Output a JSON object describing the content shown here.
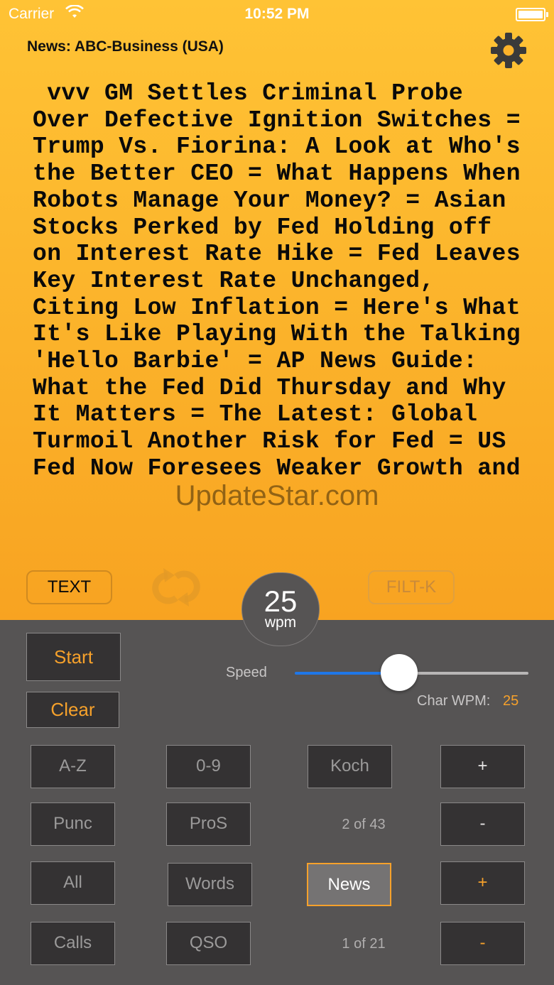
{
  "status_bar": {
    "carrier": "Carrier",
    "time": "10:52 PM"
  },
  "header": {
    "title": "News: ABC-Business (USA)"
  },
  "feed_text": " vvv GM Settles Criminal Probe Over Defective Ignition Switches = Trump Vs. Fiorina: A Look at Who's the Better CEO = What Happens When Robots Manage Your Money? = Asian Stocks Perked by Fed Holding off on Interest Rate Hike = Fed Leaves Key Interest Rate Unchanged, Citing Low Inflation = Here's What It's Like Playing With the Talking 'Hello Barbie' = AP News Guide: What the Fed Did Thursday and Why It Matters = The Latest: Global Turmoil Another Risk for Fed = US Fed Now Foresees Weaker Growth and",
  "watermark": "UpdateStar.com",
  "mode_buttons": {
    "text": "TEXT",
    "filter": "FILT-K"
  },
  "wpm": {
    "value": "25",
    "unit": "wpm"
  },
  "controls": {
    "start": "Start",
    "clear": "Clear",
    "speed_label": "Speed",
    "speed_level": 0.45,
    "char_wpm_label": "Char WPM:",
    "char_wpm_value": "25"
  },
  "grid": {
    "az": "A-Z",
    "digits": "0-9",
    "koch": "Koch",
    "koch_plus": "+",
    "punc": "Punc",
    "pros": "ProS",
    "koch_counter": "2 of 43",
    "koch_minus": "-",
    "all": "All",
    "words": "Words",
    "news": "News",
    "news_plus": "+",
    "calls": "Calls",
    "qso": "QSO",
    "news_counter": "1 of 21",
    "news_minus": "-"
  },
  "colors": {
    "accent": "#f6a12b",
    "slider_active": "#1f77e8",
    "panel_bg": "#565454"
  }
}
